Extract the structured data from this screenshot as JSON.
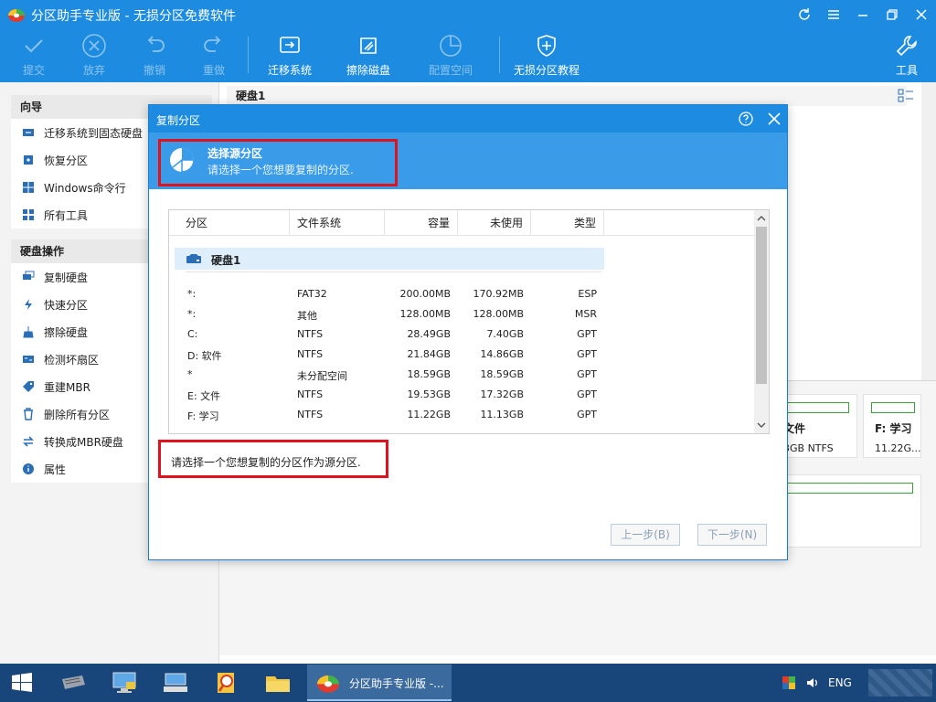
{
  "app": {
    "title": "分区助手专业版 - 无损分区免费软件"
  },
  "toolbar": {
    "submit": "提交",
    "discard": "放弃",
    "undo": "撤销",
    "redo": "重做",
    "migrate": "迁移系统",
    "wipe": "擦除磁盘",
    "config": "配置空间",
    "tutorial": "无损分区教程",
    "tools": "工具"
  },
  "sidebar": {
    "wizard_title": "向导",
    "wizard_items": [
      "迁移系统到固态硬盘",
      "恢复分区",
      "Windows命令行",
      "所有工具"
    ],
    "disk_ops_title": "硬盘操作",
    "disk_ops_items": [
      "复制硬盘",
      "快速分区",
      "擦除硬盘",
      "检测坏扇区",
      "重建MBR",
      "删除所有分区",
      "转换成MBR硬盘",
      "属性"
    ]
  },
  "main": {
    "disk_header": "硬盘1",
    "card_e_name": "文件",
    "card_e_info": "3GB NTFS",
    "card_f_name": "F: 学习",
    "card_f_info": "11.22G..."
  },
  "dialog": {
    "title": "复制分区",
    "step_title": "选择源分区",
    "step_subtitle": "请选择一个您想要复制的分区.",
    "columns": [
      "分区",
      "文件系统",
      "容量",
      "未使用",
      "类型"
    ],
    "disk_label": "硬盘1",
    "rows": [
      [
        "*:",
        "FAT32",
        "200.00MB",
        "170.92MB",
        "ESP"
      ],
      [
        "*:",
        "其他",
        "128.00MB",
        "128.00MB",
        "MSR"
      ],
      [
        "C:",
        "NTFS",
        "28.49GB",
        "7.40GB",
        "GPT"
      ],
      [
        "D: 软件",
        "NTFS",
        "21.84GB",
        "14.86GB",
        "GPT"
      ],
      [
        "*",
        "未分配空间",
        "18.59GB",
        "18.59GB",
        "GPT"
      ],
      [
        "E: 文件",
        "NTFS",
        "19.53GB",
        "17.32GB",
        "GPT"
      ],
      [
        "F: 学习",
        "NTFS",
        "11.22GB",
        "11.13GB",
        "GPT"
      ]
    ],
    "hint": "请选择一个您想复制的分区作为源分区.",
    "back_button": "上一步(B)",
    "next_button": "下一步(N)"
  },
  "taskbar": {
    "active_app_label": "分区助手专业版 -...",
    "language": "ENG"
  }
}
